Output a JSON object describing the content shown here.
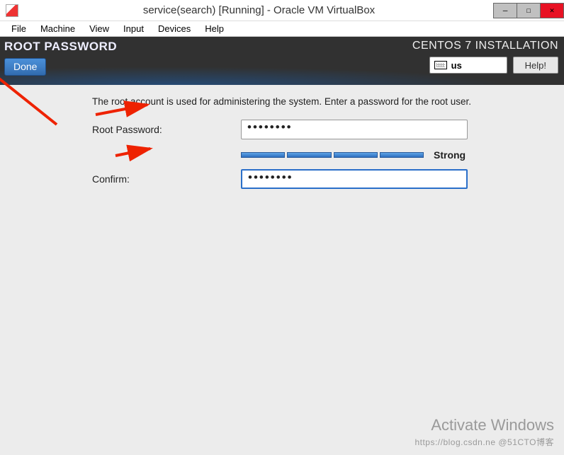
{
  "window": {
    "title": "service(search) [Running] - Oracle VM VirtualBox",
    "controls": {
      "min": "—",
      "max": "☐",
      "close": "✕"
    }
  },
  "menubar": [
    "File",
    "Machine",
    "View",
    "Input",
    "Devices",
    "Help"
  ],
  "header": {
    "page_title": "ROOT PASSWORD",
    "done_label": "Done",
    "install_title": "CENTOS 7 INSTALLATION",
    "keyboard_layout": "us",
    "help_label": "Help!"
  },
  "body": {
    "description": "The root account is used for administering the system.  Enter a password for the root user.",
    "root_label": "Root Password:",
    "root_value": "••••••••",
    "confirm_label": "Confirm:",
    "confirm_value": "••••••••",
    "strength_label": "Strong"
  },
  "watermark": {
    "line1": "Activate Windows",
    "line2": "https://blog.csdn.ne @51CTO博客"
  }
}
